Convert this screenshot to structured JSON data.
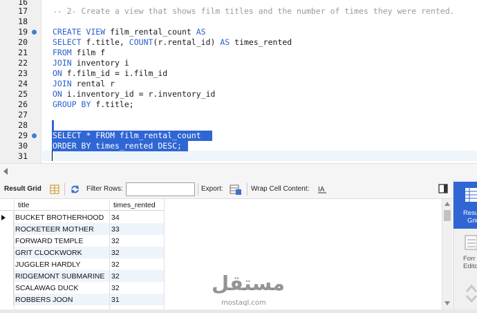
{
  "editor": {
    "lines": [
      {
        "num": "16",
        "text": ""
      },
      {
        "num": "17",
        "text": "-- 2- Create a view that shows film titles and the number of times they were rented."
      },
      {
        "num": "18",
        "text": ""
      },
      {
        "num": "19",
        "kw1": "CREATE VIEW",
        "rest1": " film_rental_count ",
        "kw2": "AS"
      },
      {
        "num": "20",
        "kw1": "SELECT",
        "rest1": " f.title, ",
        "kw2": "COUNT",
        "rest2": "(r.rental_id) ",
        "kw3": "AS",
        "rest3": " times_rented"
      },
      {
        "num": "21",
        "kw1": "FROM",
        "rest1": " film f"
      },
      {
        "num": "22",
        "kw1": "JOIN",
        "rest1": " inventory i"
      },
      {
        "num": "23",
        "kw1": "ON",
        "rest1": " f.film_id = i.film_id"
      },
      {
        "num": "24",
        "kw1": "JOIN",
        "rest1": " rental r"
      },
      {
        "num": "25",
        "kw1": "ON",
        "rest1": " i.inventory_id = r.inventory_id"
      },
      {
        "num": "26",
        "kw1": "GROUP BY",
        "rest1": " f.title;"
      },
      {
        "num": "27",
        "text": ""
      },
      {
        "num": "28",
        "text": ""
      },
      {
        "num": "29",
        "text": "SELECT * FROM film_rental_count "
      },
      {
        "num": "30",
        "text": "ORDER BY times_rented DESC;"
      },
      {
        "num": "31",
        "text": ""
      }
    ]
  },
  "toolbar": {
    "result_grid_label": "Result Grid",
    "filter_rows_label": "Filter Rows:",
    "filter_value": "",
    "export_label": "Export:",
    "wrap_label": "Wrap Cell Content:"
  },
  "grid": {
    "columns": [
      "title",
      "times_rented"
    ],
    "rows": [
      [
        "BUCKET BROTHERHOOD",
        "34"
      ],
      [
        "ROCKETEER MOTHER",
        "33"
      ],
      [
        "FORWARD TEMPLE",
        "32"
      ],
      [
        "GRIT CLOCKWORK",
        "32"
      ],
      [
        "JUGGLER HARDLY",
        "32"
      ],
      [
        "RIDGEMONT SUBMARINE",
        "32"
      ],
      [
        "SCALAWAG DUCK",
        "32"
      ],
      [
        "ROBBERS JOON",
        "31"
      ]
    ]
  },
  "sidepanel": {
    "result_grid_label_1": "Resu",
    "result_grid_label_2": "Grid",
    "form_editor_label_1": "Forr",
    "form_editor_label_2": "Edito"
  },
  "watermark": {
    "arabic": "مستقل",
    "latin": "mostaql.com"
  },
  "colors": {
    "keyword": "#2b5fcf",
    "comment": "#9a9a9a",
    "selection": "#2f66d4",
    "alt_row": "#eef4fb"
  }
}
